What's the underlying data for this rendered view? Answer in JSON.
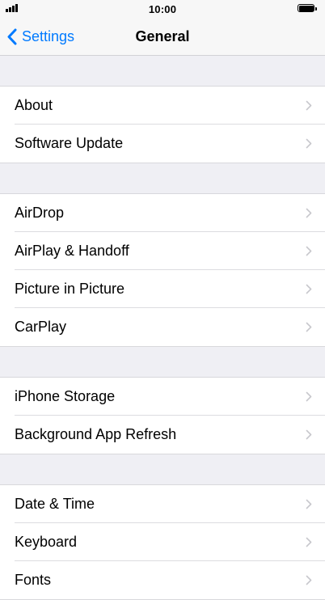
{
  "status_bar": {
    "time": "10:00"
  },
  "nav": {
    "back_label": "Settings",
    "title": "General"
  },
  "groups": [
    {
      "items": [
        {
          "label": "About"
        },
        {
          "label": "Software Update"
        }
      ]
    },
    {
      "items": [
        {
          "label": "AirDrop"
        },
        {
          "label": "AirPlay & Handoff"
        },
        {
          "label": "Picture in Picture"
        },
        {
          "label": "CarPlay"
        }
      ]
    },
    {
      "items": [
        {
          "label": "iPhone Storage"
        },
        {
          "label": "Background App Refresh"
        }
      ]
    },
    {
      "items": [
        {
          "label": "Date & Time"
        },
        {
          "label": "Keyboard"
        },
        {
          "label": "Fonts"
        }
      ]
    }
  ],
  "icons": {
    "back": "chevron-left-icon",
    "row_disclosure": "chevron-right-icon"
  },
  "colors": {
    "accent": "#007aff",
    "background": "#efeff4",
    "chevron": "#c7c7cc"
  }
}
